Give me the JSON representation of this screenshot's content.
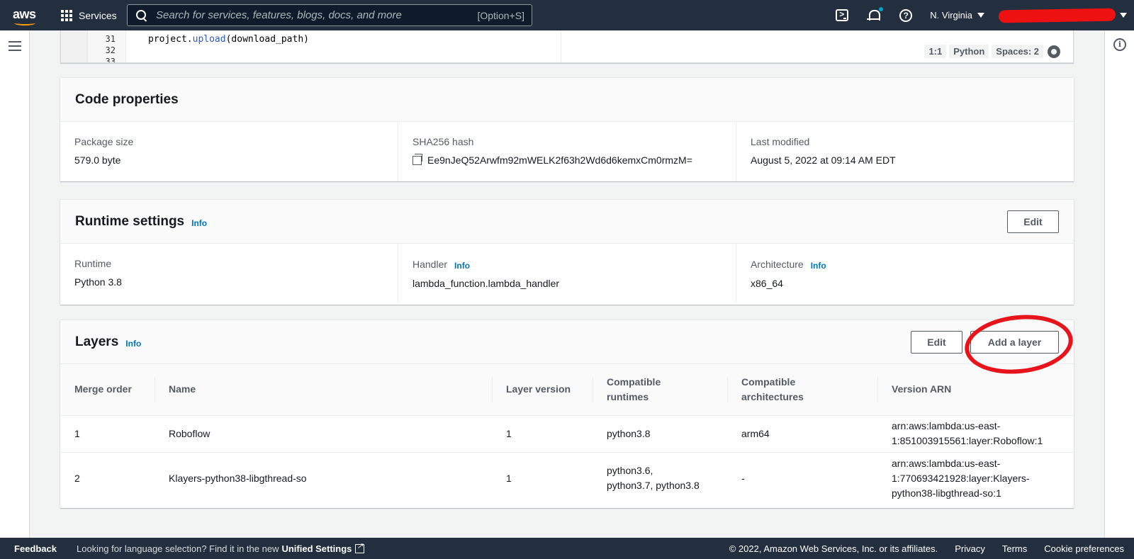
{
  "nav": {
    "logo_text": "aws",
    "services_label": "Services",
    "search_placeholder": "Search for services, features, blogs, docs, and more",
    "search_shortcut": "[Option+S]",
    "region": "N. Virginia"
  },
  "editor": {
    "lines": [
      {
        "number": "31",
        "code_prefix": "project.",
        "code_fn": "upload",
        "code_suffix": "(download_path)"
      },
      {
        "number": "32"
      },
      {
        "number": "33"
      }
    ],
    "cursor_position": "1:1",
    "language": "Python",
    "spaces": "Spaces: 2"
  },
  "code_properties": {
    "title": "Code properties",
    "package_size_label": "Package size",
    "package_size_value": "579.0 byte",
    "sha_label": "SHA256 hash",
    "sha_value": "Ee9nJeQ52Arwfm92mWELK2f63h2Wd6d6kemxCm0rmzM=",
    "modified_label": "Last modified",
    "modified_value": "August 5, 2022 at 09:14 AM EDT"
  },
  "runtime_settings": {
    "title": "Runtime settings",
    "info": "Info",
    "edit_label": "Edit",
    "runtime_label": "Runtime",
    "runtime_value": "Python 3.8",
    "handler_label": "Handler",
    "handler_info": "Info",
    "handler_value": "lambda_function.lambda_handler",
    "arch_label": "Architecture",
    "arch_info": "Info",
    "arch_value": "x86_64"
  },
  "layers": {
    "title": "Layers",
    "info": "Info",
    "edit_label": "Edit",
    "add_label": "Add a layer",
    "columns": [
      "Merge order",
      "Name",
      "Layer version",
      "Compatible runtimes",
      "Compatible architectures",
      "Version ARN"
    ],
    "rows": [
      {
        "merge_order": "1",
        "name": "Roboflow",
        "version": "1",
        "runtimes": "python3.8",
        "architectures": "arm64",
        "arn_line1": "arn:aws:lambda:us-east-",
        "arn_line2": "1:851003915561:layer:Roboflow:1",
        "arn_line3": ""
      },
      {
        "merge_order": "2",
        "name": "Klayers-python38-libgthread-so",
        "version": "1",
        "runtimes_line1": "python3.6,",
        "runtimes_line2": "python3.7, python3.8",
        "architectures": "-",
        "arn_line1": "arn:aws:lambda:us-east-",
        "arn_line2": "1:770693421928:layer:Klayers-",
        "arn_line3": "python38-libgthread-so:1"
      }
    ]
  },
  "footer": {
    "feedback": "Feedback",
    "lang_prompt": "Looking for language selection? Find it in the new",
    "unified_settings": "Unified Settings",
    "copyright": "© 2022, Amazon Web Services, Inc. or its affiliates.",
    "privacy": "Privacy",
    "terms": "Terms",
    "cookies": "Cookie preferences"
  },
  "colors": {
    "nav_bg": "#232f3e",
    "link": "#0073bb",
    "annotation": "#e8141c",
    "accent_dot": "#00a1c9"
  }
}
